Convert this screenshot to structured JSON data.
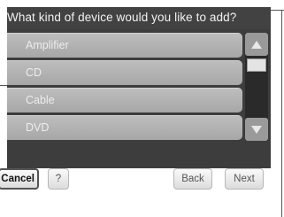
{
  "dialog": {
    "title": "What kind of device would you like to add?"
  },
  "device_list": {
    "items": [
      {
        "label": "Amplifier"
      },
      {
        "label": "CD"
      },
      {
        "label": "Cable"
      },
      {
        "label": "DVD"
      }
    ]
  },
  "scrollbar": {
    "up_icon": "triangle-up",
    "down_icon": "triangle-down"
  },
  "toolbar": {
    "cancel_label": "Cancel",
    "help_label": "?",
    "back_label": "Back",
    "next_label": "Next"
  }
}
